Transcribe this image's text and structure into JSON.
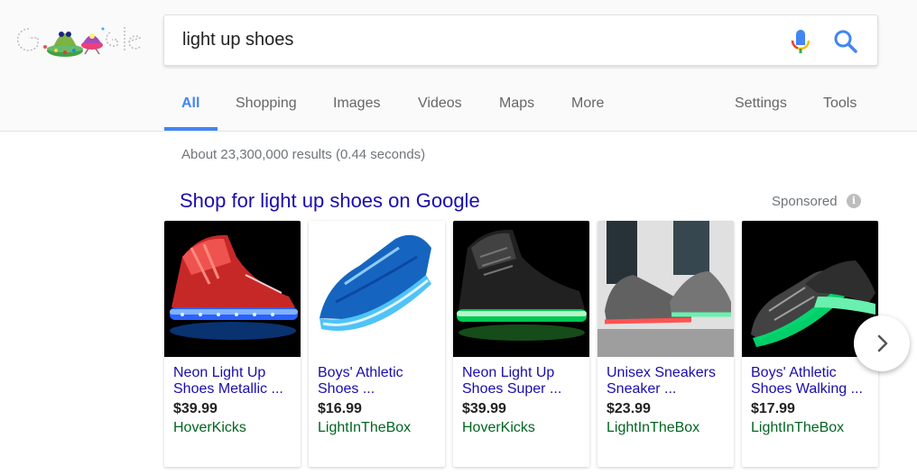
{
  "logo": {
    "alt": "Google"
  },
  "search": {
    "query": "light up shoes"
  },
  "tabs": [
    {
      "label": "All",
      "active": true
    },
    {
      "label": "Shopping"
    },
    {
      "label": "Images"
    },
    {
      "label": "Videos"
    },
    {
      "label": "Maps"
    },
    {
      "label": "More"
    }
  ],
  "tools": {
    "settings": "Settings",
    "tools": "Tools"
  },
  "result_stats": "About 23,300,000 results (0.44 seconds)",
  "shopping": {
    "title": "Shop for light up shoes on Google",
    "sponsored": "Sponsored",
    "info_icon": "i",
    "products": [
      {
        "name_line1": "Neon Light Up",
        "name_line2": "Shoes Metallic ...",
        "price": "$39.99",
        "store": "HoverKicks",
        "image": "red-metallic-high-top-led-shoe"
      },
      {
        "name_line1": "Boys' Athletic",
        "name_line2": "Shoes ...",
        "price": "$16.99",
        "store": "LightInTheBox",
        "image": "blue-knit-led-sneaker"
      },
      {
        "name_line1": "Neon Light Up",
        "name_line2": "Shoes Super ...",
        "price": "$39.99",
        "store": "HoverKicks",
        "image": "black-high-top-green-led-shoe"
      },
      {
        "name_line1": "Unisex Sneakers",
        "name_line2": "Sneaker ...",
        "price": "$23.99",
        "store": "LightInTheBox",
        "image": "grey-knit-worn-led-sneaker"
      },
      {
        "name_line1": "Boys' Athletic",
        "name_line2": "Shoes Walking ...",
        "price": "$17.99",
        "store": "LightInTheBox",
        "image": "black-knit-green-led-sneaker"
      }
    ]
  },
  "colors": {
    "link_blue": "#1a0dab",
    "accent_blue": "#4285f4",
    "store_green": "#006621",
    "text_grey": "#70757a"
  }
}
